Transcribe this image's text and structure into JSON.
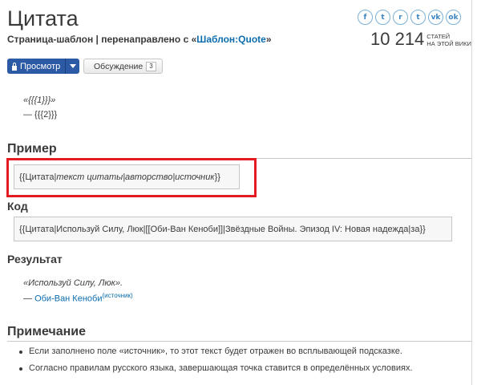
{
  "page": {
    "title": "Цитата",
    "subtitle_prefix": "Страница-шаблон | перенаправлено с «",
    "subtitle_link": "Шаблон:Quote",
    "subtitle_suffix": "»"
  },
  "social": [
    {
      "icon": "facebook-icon",
      "glyph": "f"
    },
    {
      "icon": "twitter-icon",
      "glyph": "t"
    },
    {
      "icon": "reddit-icon",
      "glyph": "r"
    },
    {
      "icon": "tumblr-icon",
      "glyph": "t"
    },
    {
      "icon": "vk-icon",
      "glyph": "vk"
    },
    {
      "icon": "odnoklassniki-icon",
      "glyph": "ok"
    }
  ],
  "stats": {
    "count": "10 214",
    "label_line1": "статей",
    "label_line2": "на этой вики"
  },
  "toolbar": {
    "view_label": "Просмотр",
    "talk_label": "Обсуждение",
    "talk_count": "3"
  },
  "template_preview": {
    "line1": "«{{{1}}}»",
    "line2": "— {{{2}}}"
  },
  "sections": {
    "example": "Пример",
    "code": "Код",
    "result": "Результат",
    "note": "Примечание"
  },
  "example_code": {
    "part1": "{{Цитата|",
    "part2": "текст цитаты|авторство|источник",
    "part3": "}}"
  },
  "code_text": "{{Цитата|Используй Силу, Люк|[[Оби-Ван Кеноби]]|Звёздные Войны. Эпизод IV: Новая надежда|за}}",
  "result": {
    "quote": "«Используй Силу, Люк».",
    "dash": "— ",
    "author_link": "Оби-Ван Кеноби",
    "source_sup": "(источник)"
  },
  "notes": [
    "Если заполнено поле «источник», то этот текст будет отражен во всплывающей подсказке.",
    "Согласно правилам русского языка, завершающая точка ставится в определённых условиях."
  ],
  "colors": {
    "link": "#0b6dae",
    "button_primary": "#2c5aa5",
    "highlight_border": "#e31b23"
  }
}
